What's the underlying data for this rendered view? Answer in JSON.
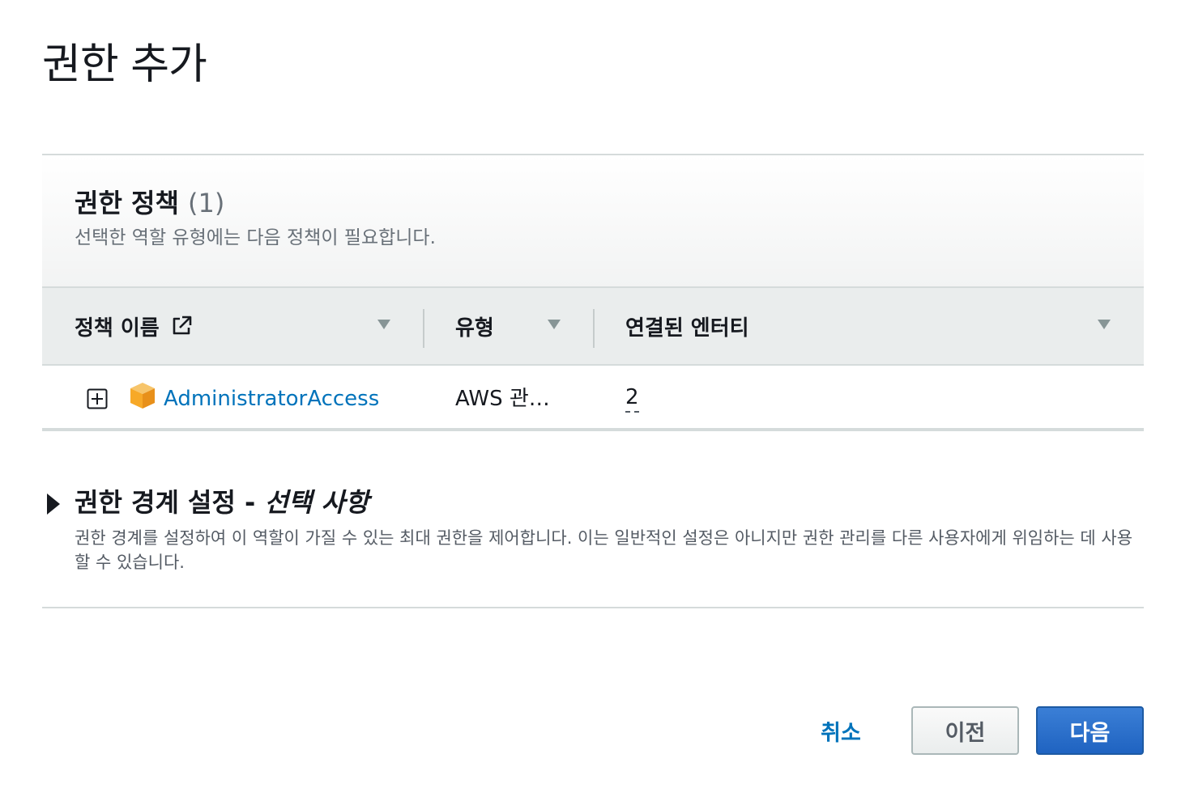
{
  "page": {
    "title": "권한 추가"
  },
  "policies": {
    "heading": "권한 정책",
    "count": "(1)",
    "description": "선택한 역할 유형에는 다음 정책이 필요합니다.",
    "columns": {
      "name": "정책 이름",
      "type": "유형",
      "entities": "연결된 엔터티"
    },
    "rows": [
      {
        "name": "AdministratorAccess",
        "type": "AWS 관리형",
        "entities": "2"
      }
    ]
  },
  "boundary": {
    "title": "권한 경계 설정 - ",
    "optional": "선택 사항",
    "description": "권한 경계를 설정하여 이 역할이 가질 수 있는 최대 권한을 제어합니다. 이는 일반적인 설정은 아니지만 권한 관리를 다른 사용자에게 위임하는 데 사용할 수 있습니다."
  },
  "footer": {
    "cancel_label": "취소",
    "previous_label": "이전",
    "next_label": "다음"
  },
  "colors": {
    "link": "#0073bb",
    "primary_button": "#1f63c1",
    "policy_icon": "#f7a928"
  },
  "icons": {
    "external_link": "external-link-icon",
    "expand": "plus-box-icon",
    "policy": "aws-box-icon",
    "sort": "caret-down-icon",
    "section_toggle": "caret-right-icon"
  }
}
